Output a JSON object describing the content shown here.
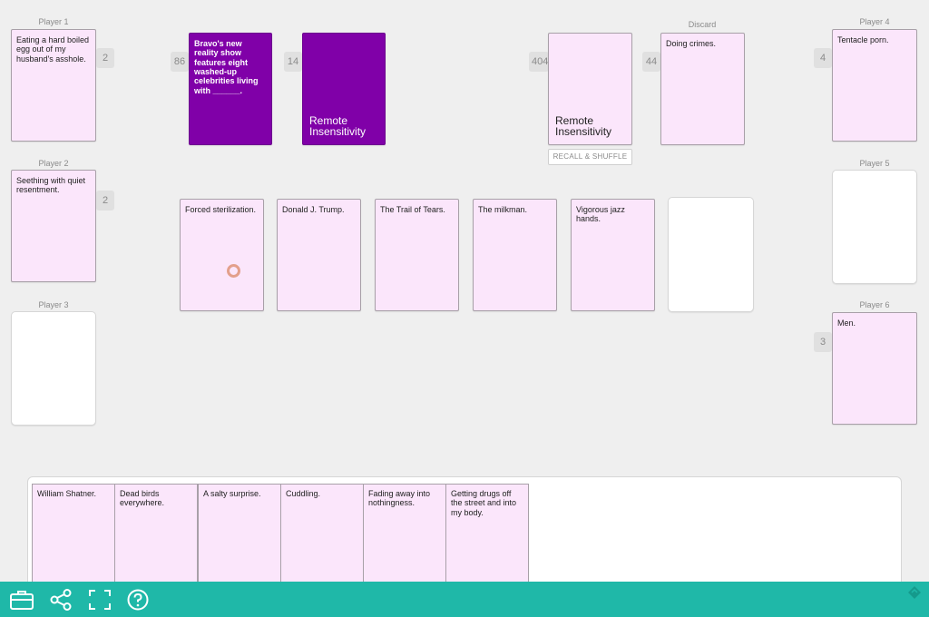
{
  "players": [
    {
      "label": "Player 1",
      "card": "Eating a hard boiled egg out of my husband's asshole.",
      "count": "2"
    },
    {
      "label": "Player 2",
      "card": "Seething with quiet resentment.",
      "count": "2"
    },
    {
      "label": "Player 3",
      "card": "",
      "count": ""
    },
    {
      "label": "Player 4",
      "card": "Tentacle porn.",
      "count": "4"
    },
    {
      "label": "Player 5",
      "card": "",
      "count": ""
    },
    {
      "label": "Player 6",
      "card": "Men.",
      "count": "3"
    }
  ],
  "black_deck": {
    "count": "86",
    "card": "Bravo's new reality show features eight washed-up celebrities living with ______."
  },
  "black_discard": {
    "count": "14",
    "card": "Remote Insensitivity"
  },
  "white_deck": {
    "count": "404",
    "card": "Remote Insensitivity",
    "button": "RECALL & SHUFFLE"
  },
  "discard": {
    "label": "Discard",
    "count": "44",
    "card": "Doing crimes."
  },
  "table_cards": [
    "Forced sterilization.",
    "Donald J. Trump.",
    "The Trail of Tears.",
    "The milkman.",
    "Vigorous jazz hands.",
    ""
  ],
  "hand": [
    "William Shatner.",
    "Dead birds everywhere.",
    "A salty surprise.",
    "Cuddling.",
    "Fading away into nothingness.",
    "Getting drugs off the street and into my body."
  ],
  "toolbar": {
    "icons": [
      "briefcase-icon",
      "share-icon",
      "fullscreen-icon",
      "help-icon"
    ]
  },
  "colors": {
    "card_pink": "#fbe6fb",
    "black_card": "#8000a8",
    "toolbar": "#1fb8a8"
  }
}
